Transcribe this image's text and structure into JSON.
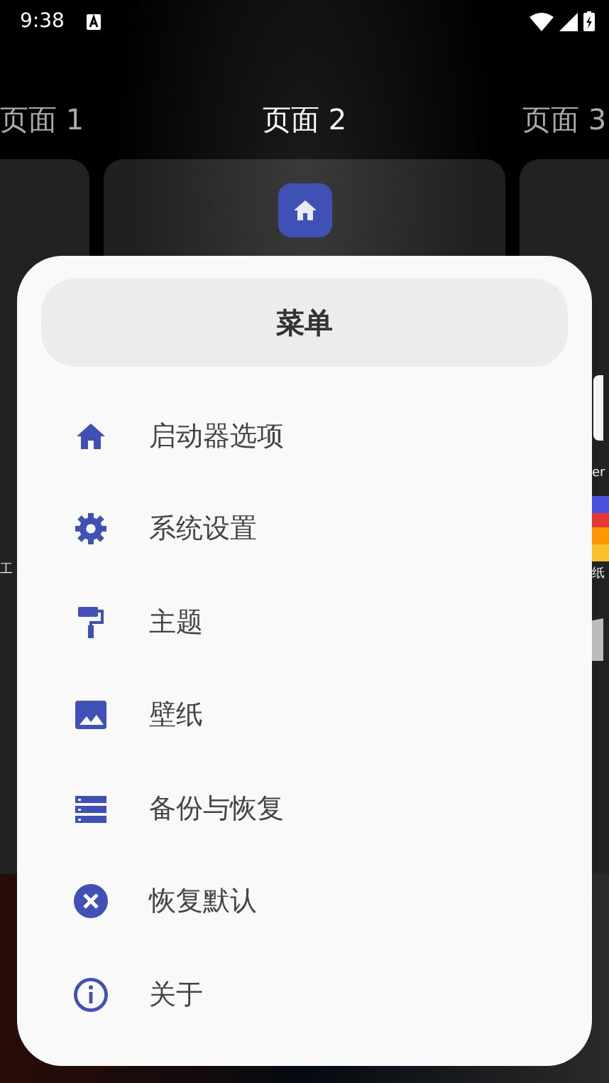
{
  "status_bar": {
    "time": "9:38"
  },
  "pages": [
    {
      "label": "页面 1",
      "selected": false
    },
    {
      "label": "页面 2",
      "selected": true
    },
    {
      "label": "页面 3",
      "selected": false
    }
  ],
  "background_fragments": [
    {
      "text": "工"
    },
    {
      "text": "er"
    },
    {
      "text": "纸"
    }
  ],
  "menu": {
    "title": "菜单",
    "items": [
      {
        "kind": "home",
        "label": "启动器选项"
      },
      {
        "kind": "settings",
        "label": "系统设置"
      },
      {
        "kind": "theme",
        "label": "主题"
      },
      {
        "kind": "wallpaper",
        "label": "壁纸"
      },
      {
        "kind": "backup",
        "label": "备份与恢复"
      },
      {
        "kind": "reset",
        "label": "恢复默认"
      },
      {
        "kind": "about",
        "label": "关于"
      }
    ]
  }
}
